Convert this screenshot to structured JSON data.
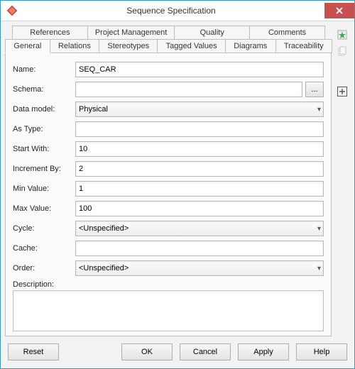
{
  "window": {
    "title": "Sequence Specification"
  },
  "tabs_row_back": [
    "References",
    "Project Management",
    "Quality",
    "Comments"
  ],
  "tabs_row_front": [
    "General",
    "Relations",
    "Stereotypes",
    "Tagged Values",
    "Diagrams",
    "Traceability"
  ],
  "active_tab": "General",
  "form": {
    "name": {
      "label": "Name:",
      "value": "SEQ_CAR"
    },
    "schema": {
      "label": "Schema:",
      "value": "",
      "browse": "..."
    },
    "data_model": {
      "label": "Data model:",
      "value": "Physical"
    },
    "as_type": {
      "label": "As Type:",
      "value": ""
    },
    "start_with": {
      "label": "Start With:",
      "value": "10"
    },
    "increment_by": {
      "label": "Increment By:",
      "value": "2"
    },
    "min_value": {
      "label": "Min Value:",
      "value": "1"
    },
    "max_value": {
      "label": "Max Value:",
      "value": "100"
    },
    "cycle": {
      "label": "Cycle:",
      "value": "<Unspecified>"
    },
    "cache": {
      "label": "Cache:",
      "value": ""
    },
    "order": {
      "label": "Order:",
      "value": "<Unspecified>"
    },
    "description": {
      "label": "Description:",
      "value": ""
    }
  },
  "footer": {
    "reset": "Reset",
    "ok": "OK",
    "cancel": "Cancel",
    "apply": "Apply",
    "help": "Help"
  },
  "side_icons": {
    "pin": "pin-star-icon",
    "copy": "copy-icon",
    "add": "add-square-icon"
  }
}
